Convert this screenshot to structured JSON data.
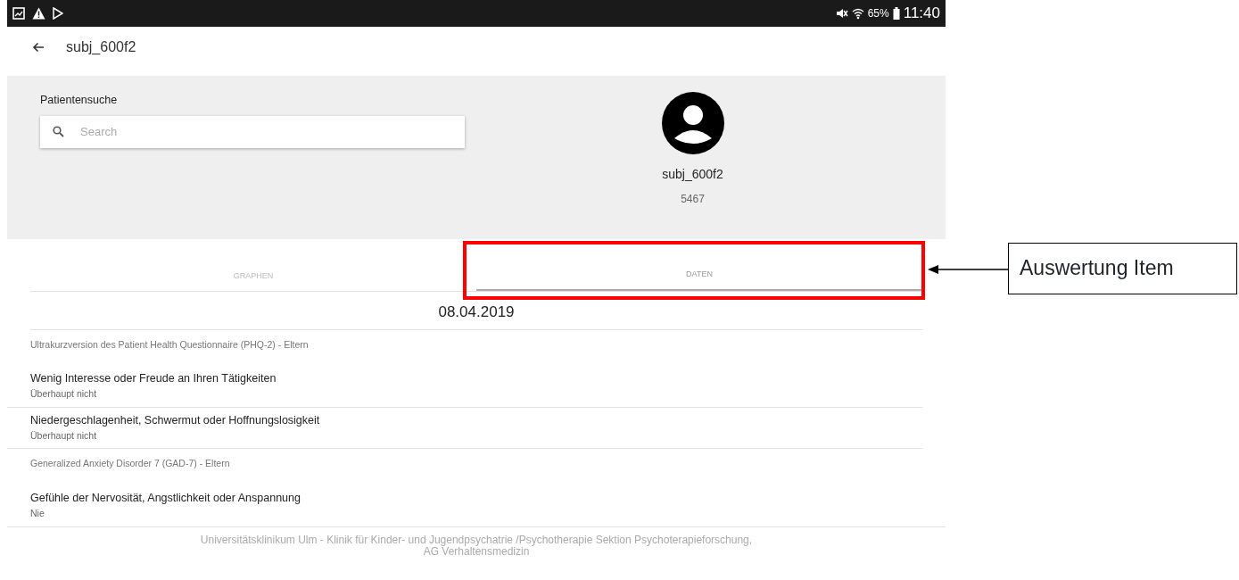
{
  "status_bar": {
    "battery": "65%",
    "time": "11:40"
  },
  "app_bar": {
    "title": "subj_600f2"
  },
  "patient_search": {
    "label": "Patientensuche",
    "placeholder": "Search"
  },
  "patient": {
    "name": "subj_600f2",
    "id": "5467"
  },
  "tabs": [
    {
      "label": "GRAPHEN",
      "selected": false
    },
    {
      "label": "DATEN",
      "selected": true
    }
  ],
  "date": "08.04.2019",
  "sections": [
    {
      "title": "Ultrakurzversion des Patient Health Questionnaire (PHQ-2) - Eltern",
      "items": [
        {
          "question": "Wenig Interesse oder Freude an Ihren Tätigkeiten",
          "answer": "Überhaupt nicht"
        },
        {
          "question": "Niedergeschlagenheit, Schwermut oder Hoffnungslosigkeit",
          "answer": "Überhaupt nicht"
        }
      ]
    },
    {
      "title": "Generalized Anxiety Disorder 7 (GAD-7) - Eltern",
      "items": [
        {
          "question": "Gefühle der Nervosität, Angstlichkeit oder Anspannung",
          "answer": "Nie"
        }
      ]
    }
  ],
  "footer": [
    "Universitätsklinikum Ulm - Klinik für Kinder- und Jugendpsychatrie /Psychotherapie Sektion Psychoterapieforschung,",
    "AG Verhaltensmedizin"
  ],
  "annotation": {
    "label": "Auswertung Item"
  }
}
